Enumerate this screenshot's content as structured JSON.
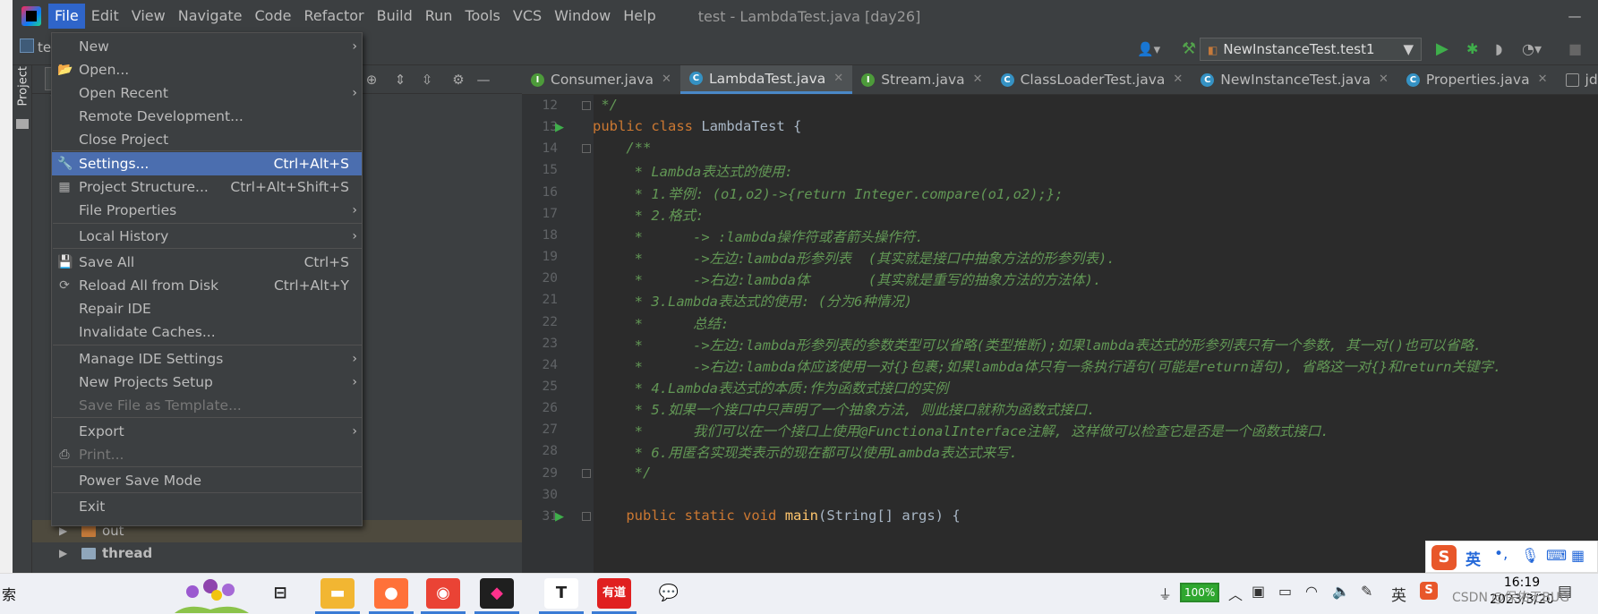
{
  "window": {
    "title": "test - LambdaTest.java [day26]",
    "project_label": "te"
  },
  "menubar": [
    "File",
    "Edit",
    "View",
    "Navigate",
    "Code",
    "Refactor",
    "Build",
    "Run",
    "Tools",
    "VCS",
    "Window",
    "Help"
  ],
  "run_config": "NewInstanceTest.test1",
  "side_panel": {
    "label": "Project"
  },
  "file_menu": [
    {
      "label": "New",
      "shortcut": "",
      "submenu": true,
      "icon": "",
      "disabled": false,
      "selected": false
    },
    {
      "label": "Open...",
      "shortcut": "",
      "submenu": false,
      "icon": "folder-open-icon",
      "disabled": false,
      "selected": false
    },
    {
      "label": "Open Recent",
      "shortcut": "",
      "submenu": true,
      "icon": "",
      "disabled": false,
      "selected": false
    },
    {
      "label": "Remote Development...",
      "shortcut": "",
      "submenu": false,
      "icon": "",
      "disabled": false,
      "selected": false
    },
    {
      "label": "Close Project",
      "shortcut": "",
      "submenu": false,
      "icon": "",
      "disabled": false,
      "selected": false
    },
    {
      "label": "Settings...",
      "shortcut": "Ctrl+Alt+S",
      "submenu": false,
      "icon": "wrench-icon",
      "disabled": false,
      "selected": true
    },
    {
      "label": "Project Structure...",
      "shortcut": "Ctrl+Alt+Shift+S",
      "submenu": false,
      "icon": "project-structure-icon",
      "disabled": false,
      "selected": false
    },
    {
      "label": "File Properties",
      "shortcut": "",
      "submenu": true,
      "icon": "",
      "disabled": false,
      "selected": false
    },
    {
      "label": "Local History",
      "shortcut": "",
      "submenu": true,
      "icon": "",
      "disabled": false,
      "selected": false
    },
    {
      "label": "Save All",
      "shortcut": "Ctrl+S",
      "submenu": false,
      "icon": "save-icon",
      "disabled": false,
      "selected": false
    },
    {
      "label": "Reload All from Disk",
      "shortcut": "Ctrl+Alt+Y",
      "submenu": false,
      "icon": "reload-icon",
      "disabled": false,
      "selected": false
    },
    {
      "label": "Repair IDE",
      "shortcut": "",
      "submenu": false,
      "icon": "",
      "disabled": false,
      "selected": false
    },
    {
      "label": "Invalidate Caches...",
      "shortcut": "",
      "submenu": false,
      "icon": "",
      "disabled": false,
      "selected": false
    },
    {
      "label": "Manage IDE Settings",
      "shortcut": "",
      "submenu": true,
      "icon": "",
      "disabled": false,
      "selected": false
    },
    {
      "label": "New Projects Setup",
      "shortcut": "",
      "submenu": true,
      "icon": "",
      "disabled": false,
      "selected": false
    },
    {
      "label": "Save File as Template...",
      "shortcut": "",
      "submenu": false,
      "icon": "",
      "disabled": true,
      "selected": false
    },
    {
      "label": "Export",
      "shortcut": "",
      "submenu": true,
      "icon": "",
      "disabled": false,
      "selected": false
    },
    {
      "label": "Print...",
      "shortcut": "",
      "submenu": false,
      "icon": "print-icon",
      "disabled": true,
      "selected": false
    },
    {
      "label": "Power Save Mode",
      "shortcut": "",
      "submenu": false,
      "icon": "",
      "disabled": false,
      "selected": false
    },
    {
      "label": "Exit",
      "shortcut": "",
      "submenu": false,
      "icon": "",
      "disabled": false,
      "selected": false
    }
  ],
  "tree": [
    {
      "name": "out",
      "bold": false
    },
    {
      "name": "thread",
      "bold": true
    }
  ],
  "tabs": [
    {
      "label": "Consumer.java",
      "icon": "I",
      "color": "#4d9b3a",
      "active": false
    },
    {
      "label": "LambdaTest.java",
      "icon": "C",
      "color": "#3592c4",
      "active": true
    },
    {
      "label": "Stream.java",
      "icon": "I",
      "color": "#4d9b3a",
      "active": false
    },
    {
      "label": "ClassLoaderTest.java",
      "icon": "C",
      "color": "#3592c4",
      "active": false
    },
    {
      "label": "NewInstanceTest.java",
      "icon": "C",
      "color": "#3592c4",
      "active": false
    },
    {
      "label": "Properties.java",
      "icon": "C",
      "color": "#3592c4",
      "active": false
    },
    {
      "label": "jdbc.prop",
      "icon": "",
      "color": "#999999",
      "active": false
    }
  ],
  "code_lines": [
    {
      "n": "12",
      "text": " */",
      "kind": "cm"
    },
    {
      "n": "13",
      "text": "public class LambdaTest {",
      "kind": "decl"
    },
    {
      "n": "14",
      "text": "    /**",
      "kind": "cm"
    },
    {
      "n": "15",
      "text": "     * Lambda表达式的使用:",
      "kind": "cm"
    },
    {
      "n": "16",
      "text": "     * 1.举例: (o1,o2)->{return Integer.compare(o1,o2);};",
      "kind": "cm"
    },
    {
      "n": "17",
      "text": "     * 2.格式:",
      "kind": "cm"
    },
    {
      "n": "18",
      "text": "     *      -> :lambda操作符或者箭头操作符.",
      "kind": "cm"
    },
    {
      "n": "19",
      "text": "     *      ->左边:lambda形参列表  (其实就是接口中抽象方法的形参列表).",
      "kind": "cm"
    },
    {
      "n": "20",
      "text": "     *      ->右边:lambda体       (其实就是重写的抽象方法的方法体).",
      "kind": "cm"
    },
    {
      "n": "21",
      "text": "     * 3.Lambda表达式的使用: (分为6种情况)",
      "kind": "cm"
    },
    {
      "n": "22",
      "text": "     *      总结:",
      "kind": "cm"
    },
    {
      "n": "23",
      "text": "     *      ->左边:lambda形参列表的参数类型可以省略(类型推断);如果lambda表达式的形参列表只有一个参数, 其一对()也可以省略.",
      "kind": "cm"
    },
    {
      "n": "24",
      "text": "     *      ->右边:lambda体应该使用一对{}包裹;如果lambda体只有一条执行语句(可能是return语句), 省略这一对{}和return关键字.",
      "kind": "cm"
    },
    {
      "n": "25",
      "text": "     * 4.Lambda表达式的本质:作为函数式接口的实例",
      "kind": "cm"
    },
    {
      "n": "26",
      "text": "     * 5.如果一个接口中只声明了一个抽象方法, 则此接口就称为函数式接口.",
      "kind": "cm"
    },
    {
      "n": "27",
      "text": "     *      我们可以在一个接口上使用@FunctionalInterface注解, 这样做可以检查它是否是一个函数式接口.",
      "kind": "cm"
    },
    {
      "n": "28",
      "text": "     * 6.用匿名实现类表示的现在都可以使用Lambda表达式来写.",
      "kind": "cm"
    },
    {
      "n": "29",
      "text": "     */",
      "kind": "cm"
    },
    {
      "n": "30",
      "text": "",
      "kind": "code"
    },
    {
      "n": "31",
      "text": "    public static void main(String[] args) {",
      "kind": "main"
    }
  ],
  "taskbar": {
    "search_text": "索",
    "battery": "100%",
    "time": "16:19",
    "date": "2023/3/20",
    "ime_lang": "英",
    "tray_lang": "英",
    "watermark": "CSDN @保佑无BUG",
    "apps": [
      {
        "name": "task-view",
        "label": ""
      },
      {
        "name": "file-explorer",
        "label": ""
      },
      {
        "name": "firefox",
        "label": ""
      },
      {
        "name": "chrome",
        "label": ""
      },
      {
        "name": "intellij",
        "label": ""
      },
      {
        "name": "typora",
        "label": "T"
      },
      {
        "name": "youdao",
        "label": "有道"
      },
      {
        "name": "wechat",
        "label": ""
      }
    ]
  },
  "colors": {
    "accent": "#4b6eaf",
    "menubar": "#3c3f41",
    "editor_bg": "#2b2b2b",
    "comment": "#629755",
    "keyword": "#cc7832"
  }
}
